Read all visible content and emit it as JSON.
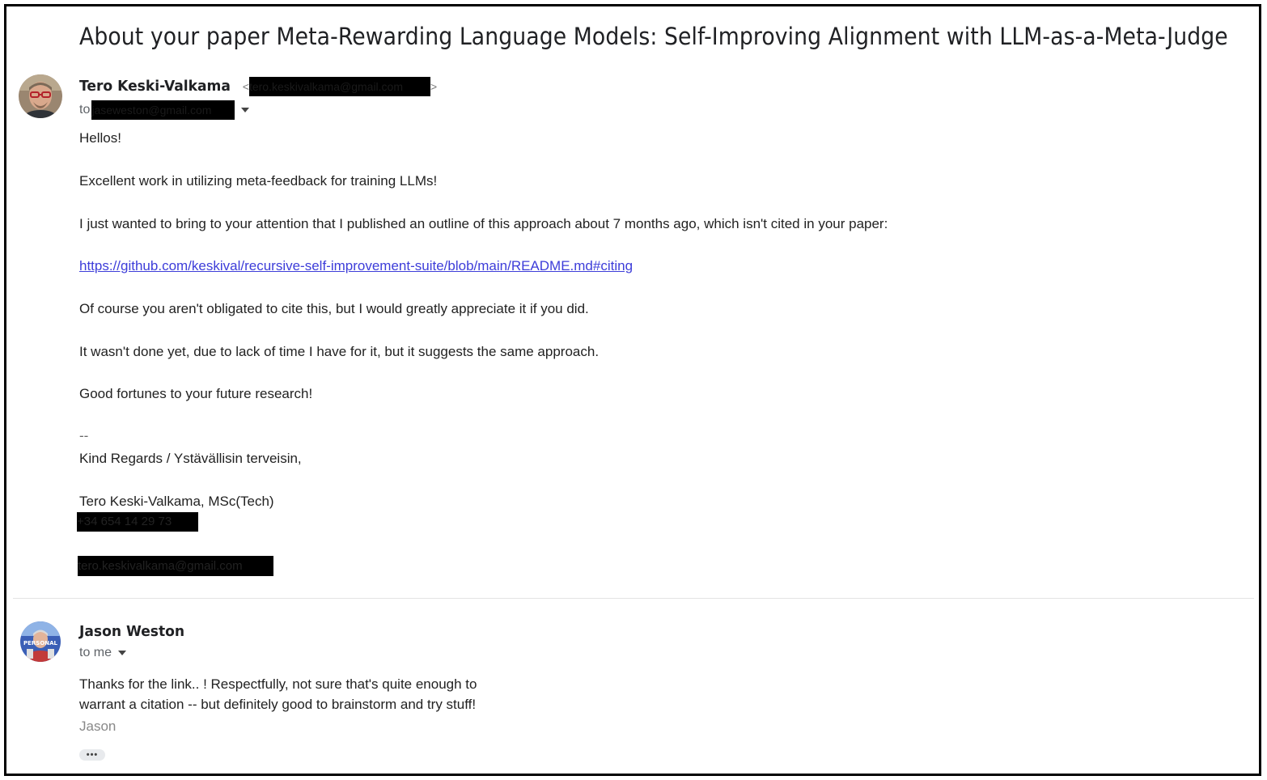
{
  "thread": {
    "subject": "About your paper Meta-Rewarding Language Models: Self-Improving Alignment with LLM-as-a-Meta-Judge"
  },
  "message1": {
    "sender_name": "Tero Keski-Valkama",
    "sender_email": "tero.keskivalkama@gmail.com",
    "to_prefix": "to",
    "to_address": "jaseweston@gmail.com",
    "greeting": "Hellos!",
    "para1": "Excellent work in utilizing meta-feedback for training LLMs!",
    "para2": "I just wanted to bring to your attention that I published an outline of this approach about 7 months ago, which isn't cited in your paper:",
    "link": "https://github.com/keskival/recursive-self-improvement-suite/blob/main/README.md#citing",
    "para3": "Of course you aren't obligated to cite this, but I would greatly appreciate it if you did.",
    "para4": "It wasn't done yet, due to lack of time I have for it, but it suggests the same approach.",
    "para5": "Good fortunes to your future research!",
    "sig_dash": "--",
    "sig_regards": "Kind Regards / Ystävällisin terveisin,",
    "sig_name": "Tero Keski-Valkama, MSc(Tech)",
    "sig_phone": "+34 654 14 29 73",
    "sig_email": "tero.keskivalkama@gmail.com"
  },
  "message2": {
    "sender_name": "Jason Weston",
    "to_label": "to me",
    "line1": "Thanks for the link.. !  Respectfully, not sure that's quite enough to",
    "line2": "warrant a citation -- but definitely good to brainstorm and try stuff!",
    "signoff": "Jason",
    "avatar_badge": "PERSONAL",
    "more_label": "•••"
  },
  "colors": {
    "link": "#3d3dd9",
    "redaction": "#000000",
    "text": "#222222",
    "muted": "#5f6368"
  }
}
